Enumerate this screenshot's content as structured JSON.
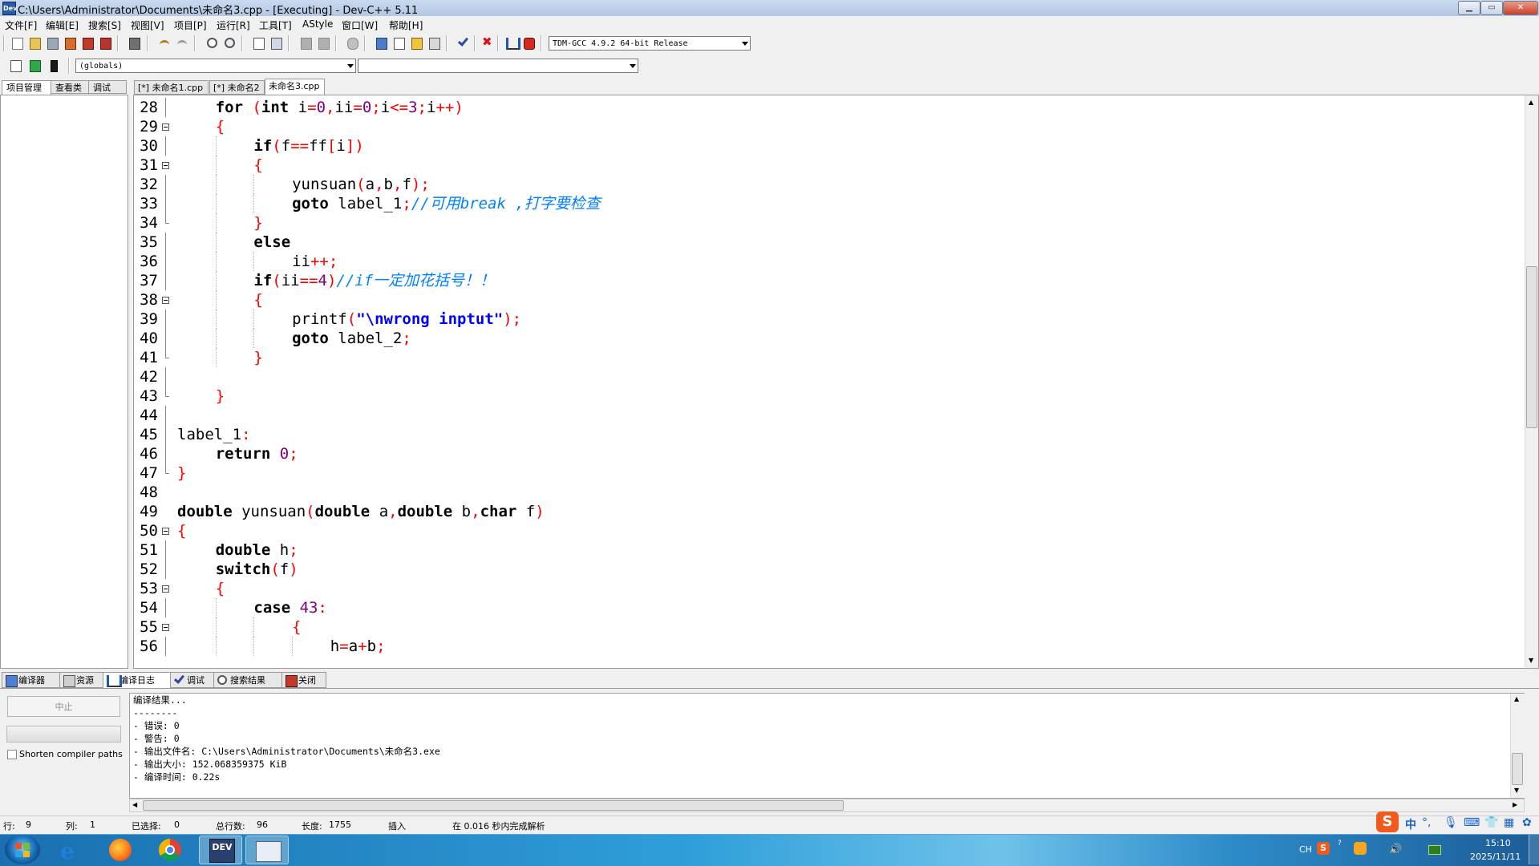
{
  "window": {
    "title": "C:\\Users\\Administrator\\Documents\\未命名3.cpp - [Executing] - Dev-C++ 5.11",
    "app_icon": "Dev"
  },
  "menu": [
    "文件[F]",
    "编辑[E]",
    "搜索[S]",
    "视图[V]",
    "项目[P]",
    "运行[R]",
    "工具[T]",
    "AStyle",
    "窗口[W]",
    "帮助[H]"
  ],
  "toolbar": {
    "compiler_select": "TDM-GCC 4.9.2 64-bit Release",
    "scope_select": "(globals)",
    "function_select": ""
  },
  "left_tabs": [
    "项目管理",
    "查看类",
    "调试"
  ],
  "editor_tabs": [
    "[*] 未命名1.cpp",
    "[*] 未命名2",
    "未命名3.cpp"
  ],
  "code": [
    {
      "n": "28",
      "fold": "line",
      "indent": 1,
      "t": [
        [
          "for ",
          "kw"
        ],
        [
          "(",
          "sym"
        ],
        [
          "int ",
          "kw"
        ],
        [
          "i",
          "x"
        ],
        [
          "=",
          "sym"
        ],
        [
          "0",
          "num"
        ],
        [
          ",",
          "sym"
        ],
        [
          "ii",
          "x"
        ],
        [
          "=",
          "sym"
        ],
        [
          "0",
          "num"
        ],
        [
          ";",
          "sym"
        ],
        [
          "i",
          "x"
        ],
        [
          "<=",
          "sym"
        ],
        [
          "3",
          "num"
        ],
        [
          ";",
          "sym"
        ],
        [
          "i",
          "x"
        ],
        [
          "++",
          "sym"
        ],
        [
          ")",
          "sym"
        ]
      ]
    },
    {
      "n": "29",
      "fold": "box",
      "indent": 1,
      "t": [
        [
          "{",
          "sym"
        ]
      ]
    },
    {
      "n": "30",
      "fold": "line",
      "indent": 2,
      "t": [
        [
          "if",
          "kw"
        ],
        [
          "(",
          "sym"
        ],
        [
          "f",
          "x"
        ],
        [
          "==",
          "sym"
        ],
        [
          "ff",
          "x"
        ],
        [
          "[",
          "sym"
        ],
        [
          "i",
          "x"
        ],
        [
          "])",
          "sym"
        ]
      ]
    },
    {
      "n": "31",
      "fold": "box",
      "indent": 2,
      "t": [
        [
          "{",
          "sym"
        ]
      ]
    },
    {
      "n": "32",
      "fold": "line",
      "indent": 3,
      "t": [
        [
          "yunsuan",
          "x"
        ],
        [
          "(",
          "sym"
        ],
        [
          "a",
          "x"
        ],
        [
          ",",
          "sym"
        ],
        [
          "b",
          "x"
        ],
        [
          ",",
          "sym"
        ],
        [
          "f",
          "x"
        ],
        [
          ");",
          "sym"
        ]
      ]
    },
    {
      "n": "33",
      "fold": "line",
      "indent": 3,
      "t": [
        [
          "goto ",
          "kw"
        ],
        [
          "label_1",
          "x"
        ],
        [
          ";",
          "sym"
        ],
        [
          "//可用break ,打字要检查",
          "cmt"
        ]
      ]
    },
    {
      "n": "34",
      "fold": "end",
      "indent": 2,
      "t": [
        [
          "}",
          "sym"
        ]
      ]
    },
    {
      "n": "35",
      "fold": "line",
      "indent": 2,
      "t": [
        [
          "else",
          "kw"
        ]
      ]
    },
    {
      "n": "36",
      "fold": "line",
      "indent": 3,
      "t": [
        [
          "ii",
          "x"
        ],
        [
          "++;",
          "sym"
        ]
      ]
    },
    {
      "n": "37",
      "fold": "line",
      "indent": 2,
      "t": [
        [
          "if",
          "kw"
        ],
        [
          "(",
          "sym"
        ],
        [
          "ii",
          "x"
        ],
        [
          "==",
          "sym"
        ],
        [
          "4",
          "num"
        ],
        [
          ")",
          "sym"
        ],
        [
          "//if一定加花括号！！",
          "cmt"
        ]
      ]
    },
    {
      "n": "38",
      "fold": "box",
      "indent": 2,
      "t": [
        [
          "{",
          "sym"
        ]
      ]
    },
    {
      "n": "39",
      "fold": "line",
      "indent": 3,
      "t": [
        [
          "printf",
          "x"
        ],
        [
          "(",
          "sym"
        ],
        [
          "\"\\nwrong inptut\"",
          "str"
        ],
        [
          ");",
          "sym"
        ]
      ]
    },
    {
      "n": "40",
      "fold": "line",
      "indent": 3,
      "t": [
        [
          "goto ",
          "kw"
        ],
        [
          "label_2",
          "x"
        ],
        [
          ";",
          "sym"
        ]
      ]
    },
    {
      "n": "41",
      "fold": "end",
      "indent": 2,
      "t": [
        [
          "}",
          "sym"
        ]
      ]
    },
    {
      "n": "42",
      "fold": "line",
      "indent": 0,
      "t": []
    },
    {
      "n": "43",
      "fold": "end",
      "indent": 1,
      "t": [
        [
          "}",
          "sym"
        ]
      ]
    },
    {
      "n": "44",
      "fold": "line",
      "indent": 0,
      "t": []
    },
    {
      "n": "45",
      "fold": "line",
      "indent": 0,
      "t": [
        [
          "label_1",
          "x"
        ],
        [
          ":",
          "sym"
        ]
      ]
    },
    {
      "n": "46",
      "fold": "line",
      "indent": 1,
      "t": [
        [
          "return ",
          "kw"
        ],
        [
          "0",
          "num"
        ],
        [
          ";",
          "sym"
        ]
      ]
    },
    {
      "n": "47",
      "fold": "end",
      "indent": 0,
      "t": [
        [
          "}",
          "sym"
        ]
      ]
    },
    {
      "n": "48",
      "fold": "none",
      "indent": 0,
      "t": []
    },
    {
      "n": "49",
      "fold": "none",
      "indent": 0,
      "t": [
        [
          "double ",
          "kw"
        ],
        [
          "yunsuan",
          "x"
        ],
        [
          "(",
          "sym"
        ],
        [
          "double ",
          "kw"
        ],
        [
          "a",
          "x"
        ],
        [
          ",",
          "sym"
        ],
        [
          "double ",
          "kw"
        ],
        [
          "b",
          "x"
        ],
        [
          ",",
          "sym"
        ],
        [
          "char ",
          "kw"
        ],
        [
          "f",
          "x"
        ],
        [
          ")",
          "sym"
        ]
      ]
    },
    {
      "n": "50",
      "fold": "box",
      "indent": 0,
      "t": [
        [
          "{",
          "sym"
        ]
      ]
    },
    {
      "n": "51",
      "fold": "line",
      "indent": 1,
      "t": [
        [
          "double ",
          "kw"
        ],
        [
          "h",
          "x"
        ],
        [
          ";",
          "sym"
        ]
      ]
    },
    {
      "n": "52",
      "fold": "line",
      "indent": 1,
      "t": [
        [
          "switch",
          "kw"
        ],
        [
          "(",
          "sym"
        ],
        [
          "f",
          "x"
        ],
        [
          ")",
          "sym"
        ]
      ]
    },
    {
      "n": "53",
      "fold": "box",
      "indent": 1,
      "t": [
        [
          "{",
          "sym"
        ]
      ]
    },
    {
      "n": "54",
      "fold": "line",
      "indent": 2,
      "t": [
        [
          "case ",
          "kw"
        ],
        [
          "43",
          "num"
        ],
        [
          ":",
          "sym"
        ]
      ]
    },
    {
      "n": "55",
      "fold": "box",
      "indent": 3,
      "t": [
        [
          "{",
          "sym"
        ]
      ]
    },
    {
      "n": "56",
      "fold": "line",
      "indent": 4,
      "t": [
        [
          "h",
          "x"
        ],
        [
          "=",
          "sym"
        ],
        [
          "a",
          "x"
        ],
        [
          "+",
          "sym"
        ],
        [
          "b",
          "x"
        ],
        [
          ";",
          "sym"
        ]
      ]
    }
  ],
  "bottom_tabs": [
    "编译器",
    "资源",
    "编译日志",
    "调试",
    "搜索结果",
    "关闭"
  ],
  "bottom": {
    "abort_label": "中止",
    "shorten_label": "Shorten compiler paths",
    "log": [
      "编译结果...",
      "--------",
      "- 错误: 0",
      "- 警告: 0",
      "- 输出文件名: C:\\Users\\Administrator\\Documents\\未命名3.exe",
      "- 输出大小: 152.068359375 KiB",
      "- 编译时间: 0.22s"
    ]
  },
  "status": {
    "row_label": "行:",
    "row": "9",
    "col_label": "列:",
    "col": "1",
    "sel_label": "已选择:",
    "sel": "0",
    "lines_label": "总行数:",
    "lines": "96",
    "len_label": "长度:",
    "len": "1755",
    "mode": "插入",
    "parse": "在 0.016 秒内完成解析"
  },
  "taskbar": {
    "lang": "CH",
    "time": "15:10",
    "date": "2025/11/11",
    "ime_mode": "中"
  }
}
